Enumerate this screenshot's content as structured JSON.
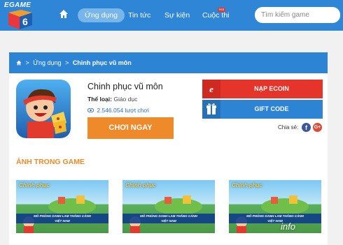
{
  "header": {
    "logo_text": "EGAME",
    "nav": [
      {
        "label": "Ứng dụng",
        "active": true
      },
      {
        "label": "Tin tức",
        "active": false
      },
      {
        "label": "Sự kiện",
        "active": false
      },
      {
        "label": "Cuộc thi",
        "active": false
      }
    ],
    "badge": "Hot",
    "search_placeholder": "Tìm kiếm game",
    "colors": {
      "bar": "#2f86d6",
      "active_pill": "#78b6ea"
    }
  },
  "breadcrumb": {
    "items": [
      "Ứng dụng",
      "Chinh phục vũ môn"
    ],
    "separator": ">"
  },
  "game": {
    "title": "Chinh phục vũ môn",
    "genre_label": "Thể loại:",
    "genre_value": "Giáo dục",
    "plays": "2.546.054 lượt chơi",
    "play_button": "CHƠI NGAY"
  },
  "actions": {
    "ecoin_label": "NẠP ECOIN",
    "ecoin_icon": "e",
    "gift_label": "GIFT CODE",
    "share_label": "Chia sẻ:",
    "colors": {
      "ecoin": "#e5342a",
      "gift": "#2d84d4",
      "play": "#ef8a2a"
    }
  },
  "screenshots": {
    "section_title": "ẢNH TRONG GAME",
    "banner_line1": "MÔ PHỎNG DANH LAM THẮNG CẢNH",
    "banner_line2": "VIỆT NAM",
    "watermark": "info"
  }
}
